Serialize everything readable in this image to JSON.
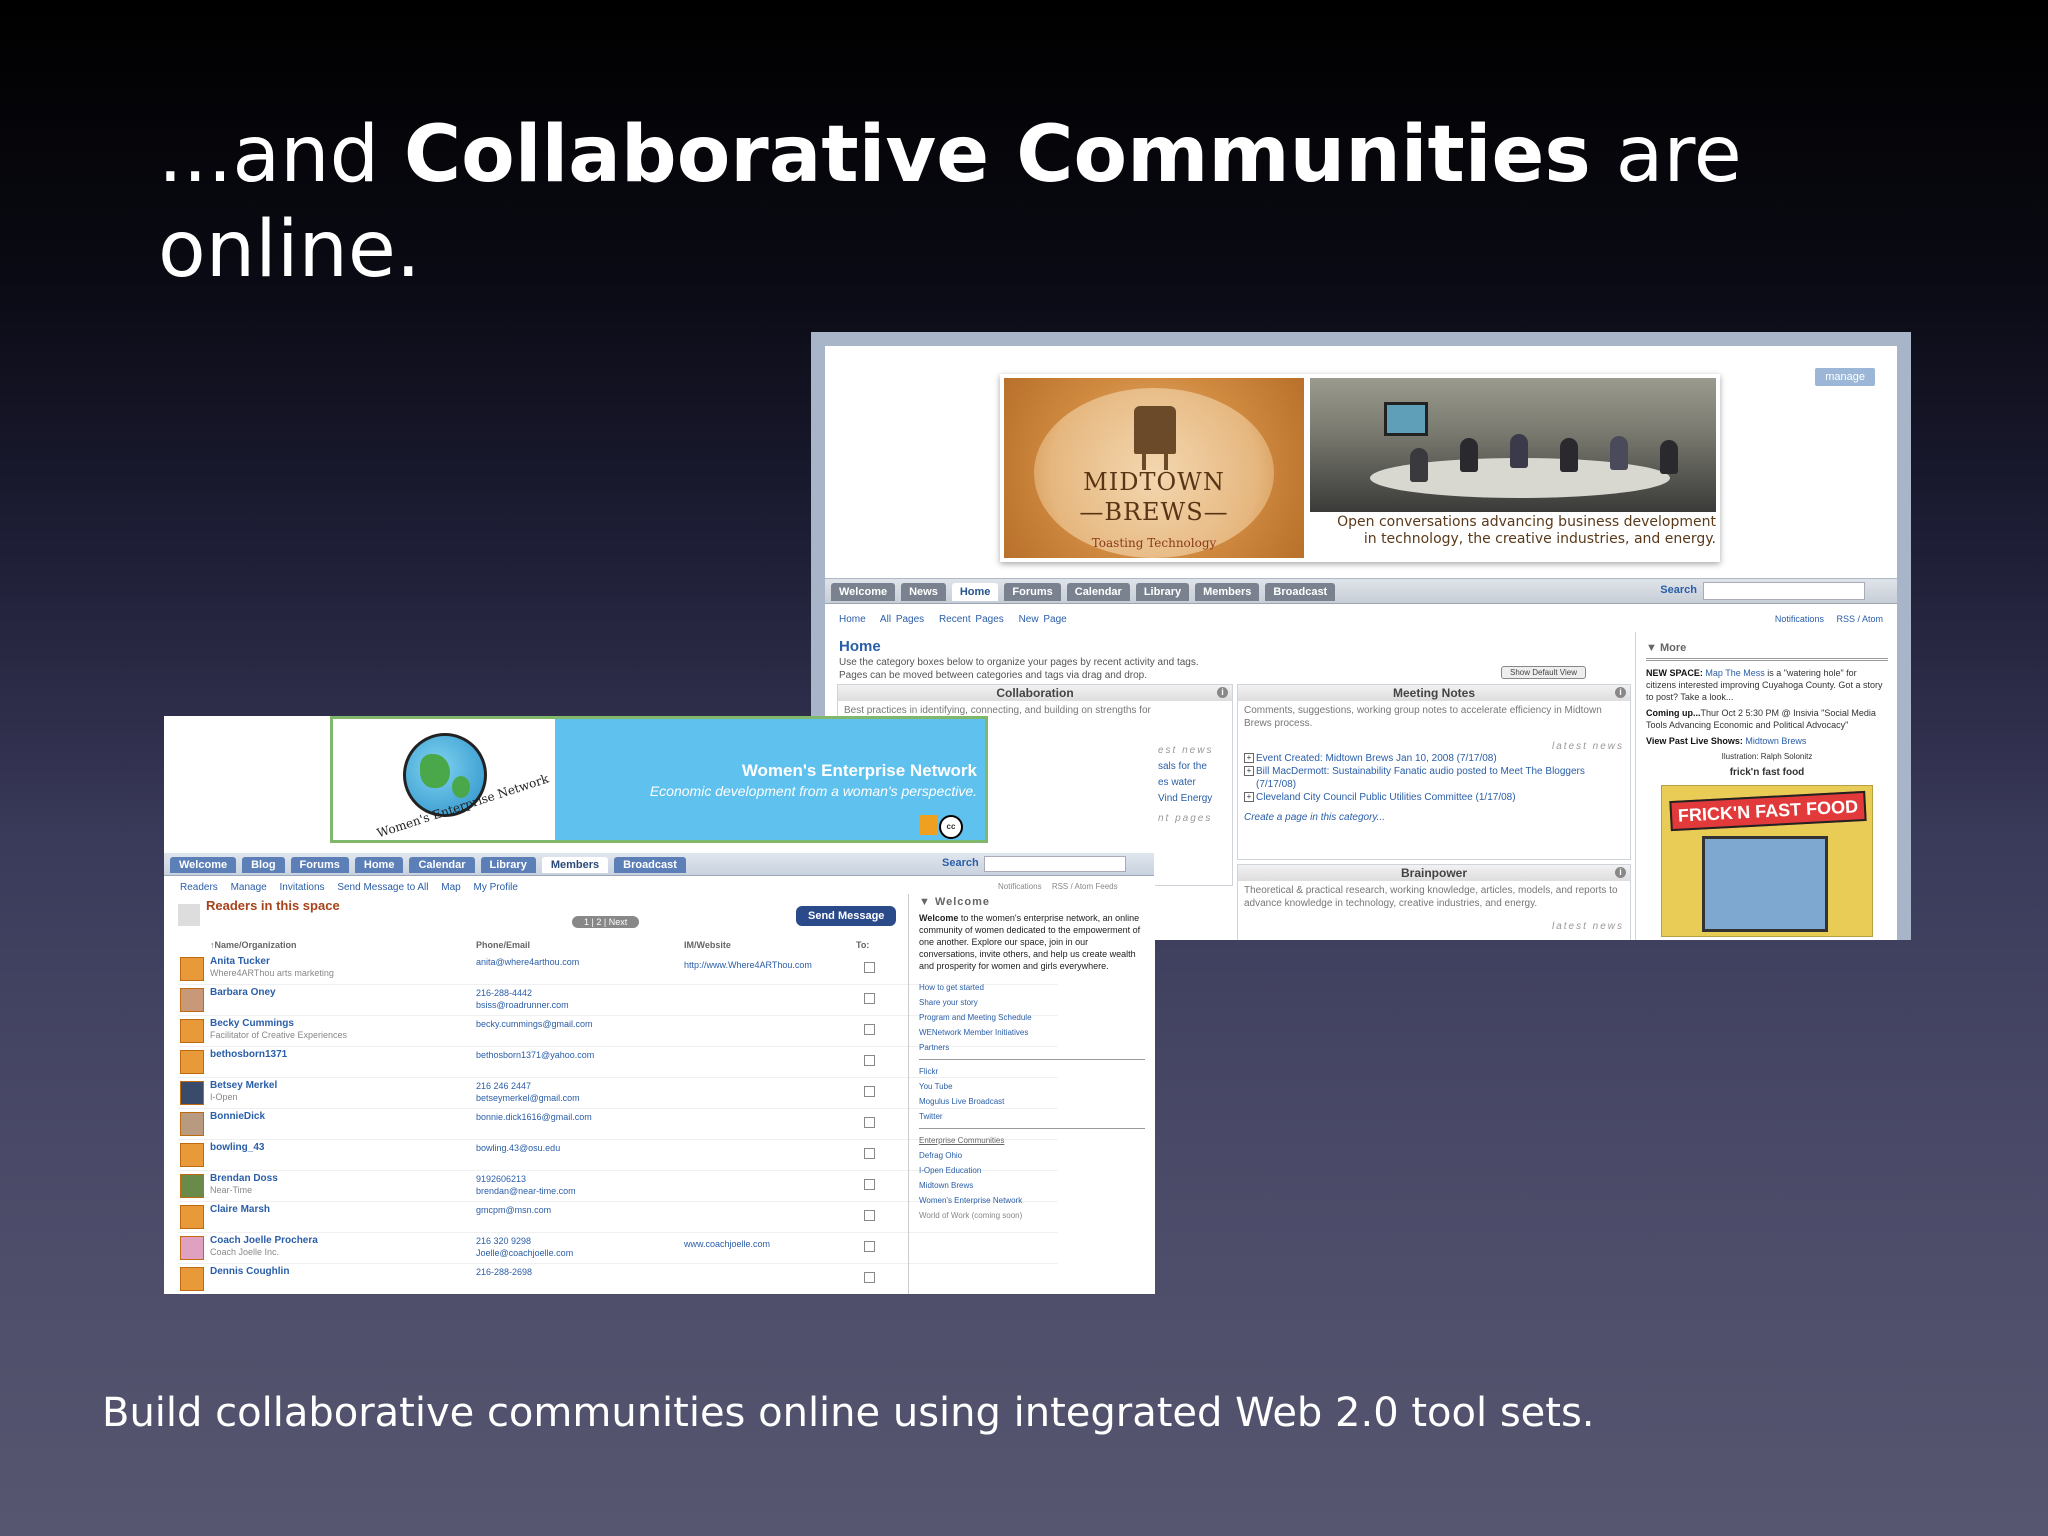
{
  "slide": {
    "title_pre": "...and ",
    "title_bold": "Collaborative Communities",
    "title_post": " are online.",
    "caption": "Build collaborative communities online using integrated Web 2.0 tool sets."
  },
  "midtown": {
    "manage": "manage",
    "logo_line1": "MIDTOWN",
    "logo_line2": "—BREWS—",
    "logo_line3": "Toasting Technology",
    "tagline_1": "Open conversations advancing business development",
    "tagline_2": "in technology, the creative industries, and energy.",
    "tabs": [
      "Welcome",
      "News",
      "Home",
      "Forums",
      "Calendar",
      "Library",
      "Members",
      "Broadcast"
    ],
    "active_tab": "Home",
    "search_label": "Search",
    "subnav": [
      "Home",
      "All Pages",
      "Recent Pages",
      "New Page"
    ],
    "feeds": [
      "Notifications",
      "RSS / Atom"
    ],
    "home_title": "Home",
    "home_desc_1": "Use the category boxes below to organize your pages by recent activity and tags.",
    "home_desc_2": "Pages can be moved between categories and tags via drag and drop.",
    "default_view": "Show Default View",
    "collab": {
      "title": "Collaboration",
      "text": "Best practices in identifying, connecting, and building on strengths for",
      "manage": "manage"
    },
    "meeting": {
      "title": "Meeting Notes",
      "text": "Comments, suggestions, working group notes to accelerate efficiency in Midtown Brews process.",
      "latest": "latest news",
      "events": [
        "Event Created: Midtown Brews Jan 10, 2008 (7/17/08)",
        "Bill MacDermott: Sustainability Fanatic audio posted to Meet The Bloggers (7/17/08)",
        "Cleveland City Council Public Utilities Committee (1/17/08)"
      ],
      "create": "Create a page in this category..."
    },
    "brainpower": {
      "title": "Brainpower",
      "text": "Theoretical & practical research, working knowledge, articles, models, and reports to advance knowledge in technology, creative industries, and energy.",
      "latest": "latest news"
    },
    "partial": {
      "line1": "est news",
      "line2": "sals for the",
      "line3": "es water",
      "line4": "Vind Energy",
      "line5": "nt pages"
    },
    "side": {
      "more": "▼ More",
      "ns_label": "NEW SPACE:",
      "ns_link": "Map The Mess",
      "ns_text": " is a \"watering hole\" for citizens interested improving Cuyahoga County. Got a story to post? Take a look...",
      "cu_label": "Coming up...",
      "cu_text": "Thur Oct 2 5:30 PM @ Insivia \"Social Media Tools Advancing Economic and Political Advocacy\"",
      "vp_label": "View Past Live Shows: ",
      "vp_link": "Midtown Brews",
      "illustration": "Ilustration: Ralph Solonitz",
      "fff": "frick'n fast food",
      "comic_title": "FRICK'N FAST FOOD"
    }
  },
  "wen": {
    "title": "Women's Enterprise Network",
    "subtitle": "Economic development from a woman's perspective.",
    "logo_text": "Women's Enterprise Network",
    "cc": "cc",
    "tabs": [
      "Welcome",
      "Blog",
      "Forums",
      "Home",
      "Calendar",
      "Library",
      "Members",
      "Broadcast"
    ],
    "active_tab": "Members",
    "search_label": "Search",
    "subnav": [
      "Readers",
      "Manage",
      "Invitations",
      "Send Message to All",
      "Map",
      "My Profile"
    ],
    "feeds": [
      "Notifications",
      "RSS / Atom Feeds"
    ],
    "readers_title": "Readers in this space",
    "pager": "1 | 2 | Next",
    "send": "Send Message",
    "headers": {
      "name": "↑Name/Organization",
      "phone": "Phone/Email",
      "im": "IM/Website",
      "to": "To:"
    },
    "members": [
      {
        "name": "Anita Tucker",
        "org": "Where4ARThou arts marketing",
        "phone": "",
        "email": "anita@where4arthou.com",
        "web": "http://www.Where4ARThou.com",
        "av": ""
      },
      {
        "name": "Barbara Oney",
        "org": "",
        "phone": "216-288-4442",
        "email": "bsiss@roadrunner.com",
        "web": "",
        "av": "photo1"
      },
      {
        "name": "Becky Cummings",
        "org": "Facilitator of Creative Experiences",
        "phone": "",
        "email": "becky.cummings@gmail.com",
        "web": "",
        "av": ""
      },
      {
        "name": "bethosborn1371",
        "org": "",
        "phone": "",
        "email": "bethosborn1371@yahoo.com",
        "web": "",
        "av": ""
      },
      {
        "name": "Betsey Merkel",
        "org": "I-Open",
        "phone": "216 246 2447",
        "email": "betseymerkel@gmail.com",
        "web": "",
        "av": "photo2"
      },
      {
        "name": "BonnieDick",
        "org": "",
        "phone": "",
        "email": "bonnie.dick1616@gmail.com",
        "web": "",
        "av": "photo3"
      },
      {
        "name": "bowling_43",
        "org": "",
        "phone": "",
        "email": "bowling.43@osu.edu",
        "web": "",
        "av": ""
      },
      {
        "name": "Brendan Doss",
        "org": "Near-Time",
        "phone": "9192606213",
        "email": "brendan@near-time.com",
        "web": "",
        "av": "photo4"
      },
      {
        "name": "Claire Marsh",
        "org": "",
        "phone": "",
        "email": "gmcpm@msn.com",
        "web": "",
        "av": ""
      },
      {
        "name": "Coach Joelle Prochera",
        "org": "Coach Joelle Inc.",
        "phone": "216 320 9298",
        "email": "Joelle@coachjoelle.com",
        "web": "www.coachjoelle.com",
        "av": "photo5"
      },
      {
        "name": "Dennis Coughlin",
        "org": "",
        "phone": "216-288-2698",
        "email": "",
        "web": "",
        "av": ""
      }
    ],
    "side": {
      "welcome": "▼ Welcome",
      "text_bold": "Welcome",
      "text": " to the women's enterprise network, an online community of women dedicated to the empowerment of one another. Explore our space, join in our conversations, invite others, and help us create wealth and prosperity for women and girls everywhere.",
      "links1": [
        "How to get started",
        "Share your story",
        "Program and Meeting Schedule",
        "WENetwork Member Initiatives",
        "Partners"
      ],
      "links2": [
        "Flickr",
        "You Tube",
        "Mogulus Live Broadcast",
        "Twitter"
      ],
      "links3_head": "Enterprise Communities",
      "links3": [
        "Defrag Ohio",
        "I-Open Education",
        "Midtown Brews",
        "Women's Enterprise Network"
      ],
      "links3_last": "World of Work (coming soon)"
    }
  }
}
